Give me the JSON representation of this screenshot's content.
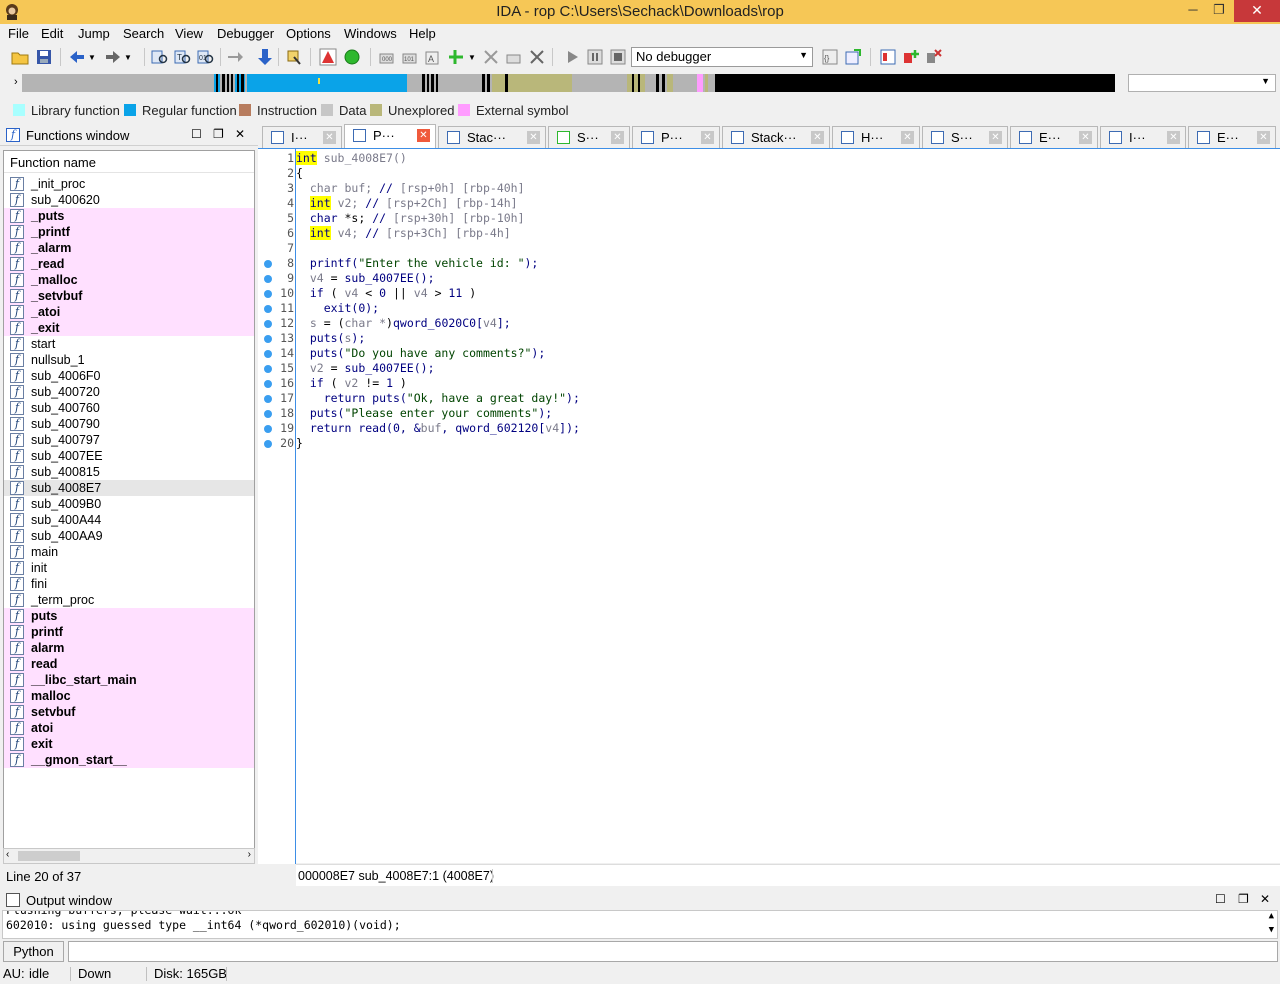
{
  "window": {
    "title": "IDA - rop C:\\Users\\Sechack\\Downloads\\rop",
    "minimize": "─",
    "restore": "❐",
    "close": "✕"
  },
  "menu": [
    "File",
    "Edit",
    "Jump",
    "Search",
    "View",
    "Debugger",
    "Options",
    "Windows",
    "Help"
  ],
  "toolbar": {
    "debugger_select": "No debugger"
  },
  "legend": [
    {
      "label": "Library function",
      "color": "#a8ffff"
    },
    {
      "label": "Regular function",
      "color": "#0aa3e8"
    },
    {
      "label": "Instruction",
      "color": "#b77c5e"
    },
    {
      "label": "Data",
      "color": "#c6c6c6"
    },
    {
      "label": "Unexplored",
      "color": "#b9b77a"
    },
    {
      "label": "External symbol",
      "color": "#ff9cff"
    }
  ],
  "functions_window": {
    "title": "Functions window",
    "column_header": "Function name",
    "status": "Line 20 of 37",
    "items": [
      {
        "name": "_init_proc",
        "ext": false
      },
      {
        "name": "sub_400620",
        "ext": false
      },
      {
        "name": "_puts",
        "ext": true
      },
      {
        "name": "_printf",
        "ext": true
      },
      {
        "name": "_alarm",
        "ext": true
      },
      {
        "name": "_read",
        "ext": true
      },
      {
        "name": "_malloc",
        "ext": true
      },
      {
        "name": "_setvbuf",
        "ext": true
      },
      {
        "name": "_atoi",
        "ext": true
      },
      {
        "name": "_exit",
        "ext": true
      },
      {
        "name": "start",
        "ext": false
      },
      {
        "name": "nullsub_1",
        "ext": false
      },
      {
        "name": "sub_4006F0",
        "ext": false
      },
      {
        "name": "sub_400720",
        "ext": false
      },
      {
        "name": "sub_400760",
        "ext": false
      },
      {
        "name": "sub_400790",
        "ext": false
      },
      {
        "name": "sub_400797",
        "ext": false
      },
      {
        "name": "sub_4007EE",
        "ext": false
      },
      {
        "name": "sub_400815",
        "ext": false
      },
      {
        "name": "sub_4008E7",
        "ext": false,
        "selected": true
      },
      {
        "name": "sub_4009B0",
        "ext": false
      },
      {
        "name": "sub_400A44",
        "ext": false
      },
      {
        "name": "sub_400AA9",
        "ext": false
      },
      {
        "name": "main",
        "ext": false
      },
      {
        "name": "init",
        "ext": false
      },
      {
        "name": "fini",
        "ext": false
      },
      {
        "name": "_term_proc",
        "ext": false
      },
      {
        "name": "puts",
        "ext": true
      },
      {
        "name": "printf",
        "ext": true
      },
      {
        "name": "alarm",
        "ext": true
      },
      {
        "name": "read",
        "ext": true
      },
      {
        "name": "__libc_start_main",
        "ext": true
      },
      {
        "name": "malloc",
        "ext": true
      },
      {
        "name": "setvbuf",
        "ext": true
      },
      {
        "name": "atoi",
        "ext": true
      },
      {
        "name": "exit",
        "ext": true
      },
      {
        "name": "__gmon_start__",
        "ext": true
      }
    ]
  },
  "tabs": [
    {
      "label": "I···"
    },
    {
      "label": "P···",
      "active": true
    },
    {
      "label": "Stac···"
    },
    {
      "label": "S···"
    },
    {
      "label": "P···"
    },
    {
      "label": "Stack···"
    },
    {
      "label": "H···"
    },
    {
      "label": "S···"
    },
    {
      "label": "E···"
    },
    {
      "label": "I···"
    },
    {
      "label": "E···"
    }
  ],
  "code_lines": [
    {
      "n": "1",
      "bp": false,
      "html": "<span class='k kw'>int</span><span class='g'> sub_4008E7()</span>"
    },
    {
      "n": "2",
      "bp": false,
      "html": "{"
    },
    {
      "n": "3",
      "bp": false,
      "html": "  <span class='g'>char buf; </span><span class='k'>// </span><span class='g'>[rsp+0h] [rbp-40h]</span>"
    },
    {
      "n": "4",
      "bp": false,
      "html": "  <span class='k kw'>int</span><span class='g'> v2; </span><span class='k'>// </span><span class='g'>[rsp+2Ch] [rbp-14h]</span>"
    },
    {
      "n": "5",
      "bp": false,
      "html": "  <span class='k'>char</span> *s; <span class='k'>// </span><span class='g'>[rsp+30h] [rbp-10h]</span>"
    },
    {
      "n": "6",
      "bp": false,
      "html": "  <span class='k kw'>int</span><span class='g'> v4; </span><span class='k'>// </span><span class='g'>[rsp+3Ch] [rbp-4h]</span>"
    },
    {
      "n": "7",
      "bp": false,
      "html": ""
    },
    {
      "n": "8",
      "bp": true,
      "html": "  <span class='k'>printf(</span><span class='s'>\"Enter the vehicle id: \"</span><span class='k'>);</span>"
    },
    {
      "n": "9",
      "bp": true,
      "html": "  <span class='g'>v4</span> = <span class='k'>sub_4007EE();</span>"
    },
    {
      "n": "10",
      "bp": true,
      "html": "  <span class='k'>if</span> ( <span class='g'>v4</span> &lt; <span class='k'>0</span> || <span class='g'>v4</span> &gt; <span class='k'>11</span> )"
    },
    {
      "n": "11",
      "bp": true,
      "html": "    <span class='k'>exit(0);</span>"
    },
    {
      "n": "12",
      "bp": true,
      "html": "  <span class='g'>s</span> = (<span class='g'>char *</span>)<span class='k'>qword_6020C0[</span><span class='g'>v4</span><span class='k'>];</span>"
    },
    {
      "n": "13",
      "bp": true,
      "html": "  <span class='k'>puts(</span><span class='g'>s</span><span class='k'>);</span>"
    },
    {
      "n": "14",
      "bp": true,
      "html": "  <span class='k'>puts(</span><span class='s'>\"Do you have any comments?\"</span><span class='k'>);</span>"
    },
    {
      "n": "15",
      "bp": true,
      "html": "  <span class='g'>v2</span> = <span class='k'>sub_4007EE();</span>"
    },
    {
      "n": "16",
      "bp": true,
      "html": "  <span class='k'>if</span> ( <span class='g'>v2</span> != <span class='k'>1</span> )"
    },
    {
      "n": "17",
      "bp": true,
      "html": "    <span class='k'>return puts(</span><span class='s'>\"Ok, have a great day!\"</span><span class='k'>);</span>"
    },
    {
      "n": "18",
      "bp": true,
      "html": "  <span class='k'>puts(</span><span class='s'>\"Please enter your comments\"</span><span class='k'>);</span>"
    },
    {
      "n": "19",
      "bp": true,
      "html": "  <span class='k'>return read(0, &amp;</span><span class='g'>buf</span><span class='k'>, qword_602120[</span><span class='g'>v4</span><span class='k'>]);</span>"
    },
    {
      "n": "20",
      "bp": true,
      "html": "}"
    }
  ],
  "code_status": "000008E7 sub_4008E7:1 (4008E7)",
  "output_window": {
    "title": "Output window",
    "lines": [
      "Flushing buffers, please wait...ok",
      "602010: using guessed type __int64 (*qword_602010)(void);"
    ]
  },
  "python_button": "Python",
  "statusbar": {
    "au": "AU:",
    "state": "idle",
    "direction": "Down",
    "disk": "Disk: 165GB"
  }
}
